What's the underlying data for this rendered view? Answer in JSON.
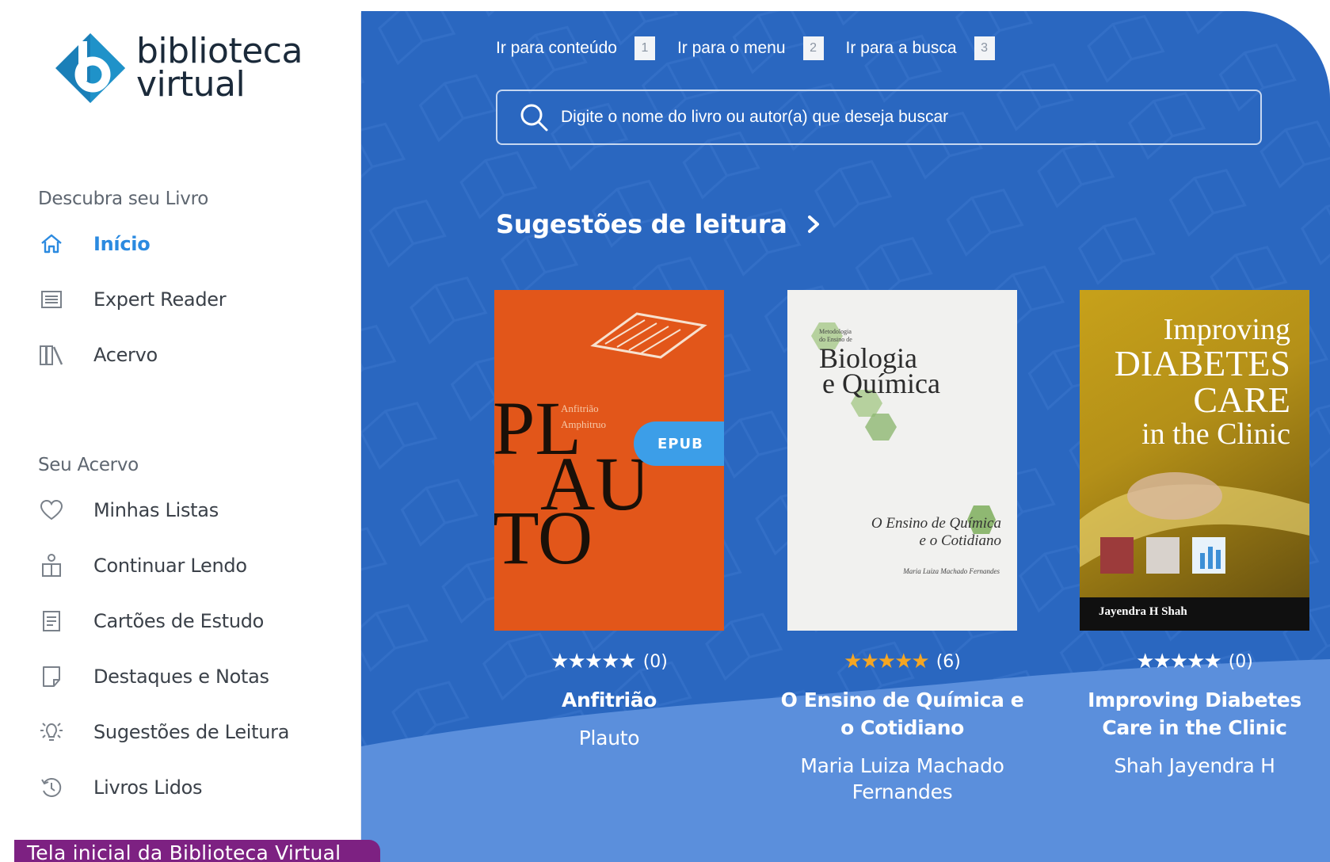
{
  "sidebar": {
    "logo": {
      "line1": "biblioteca",
      "line2": "virtual"
    },
    "sections": [
      {
        "title": "Descubra seu Livro",
        "items": [
          {
            "label": "Início",
            "icon": "home-icon",
            "active": true
          },
          {
            "label": "Expert Reader",
            "icon": "list-icon"
          },
          {
            "label": "Acervo",
            "icon": "books-icon"
          }
        ]
      },
      {
        "title": "Seu Acervo",
        "items": [
          {
            "label": "Minhas Listas",
            "icon": "heart-icon"
          },
          {
            "label": "Continuar Lendo",
            "icon": "reader-icon"
          },
          {
            "label": "Cartões de Estudo",
            "icon": "card-icon"
          },
          {
            "label": "Destaques e Notas",
            "icon": "note-icon"
          },
          {
            "label": "Sugestões de Leitura",
            "icon": "lightbulb-icon"
          },
          {
            "label": "Livros Lidos",
            "icon": "history-icon"
          }
        ]
      }
    ]
  },
  "caption": "Tela inicial da Biblioteca Virtual",
  "skiplinks": [
    {
      "label": "Ir para conteúdo",
      "key": "1"
    },
    {
      "label": "Ir para o menu",
      "key": "2"
    },
    {
      "label": "Ir para a busca",
      "key": "3"
    }
  ],
  "search": {
    "placeholder": "Digite o nome do livro ou autor(a) que deseja buscar"
  },
  "suggestions": {
    "title": "Sugestões de leitura",
    "books": [
      {
        "title": "Anfitrião",
        "author": "Plauto",
        "rating_count": "(0)",
        "rating_stars": 0,
        "badge": "EPUB",
        "cover": {
          "lines": [
            "PL",
            "AU",
            "TO"
          ],
          "subtitle": [
            "Anfitrião",
            "Amphitruo"
          ]
        }
      },
      {
        "title": "O Ensino de Química e o Cotidiano",
        "author": "Maria Luiza Machado Fernandes",
        "rating_count": "(6)",
        "rating_stars": 5,
        "cover": {
          "series": [
            "Metodologia",
            "do Ensino de"
          ],
          "heading": [
            "Biologia",
            "e Química"
          ],
          "subtitle": [
            "O Ensino de Química",
            "e o Cotidiano"
          ],
          "author": "Maria Luiza Machado Fernandes"
        }
      },
      {
        "title": "Improving Diabetes Care in the Clinic",
        "author": "Shah Jayendra H",
        "rating_count": "(0)",
        "rating_stars": 0,
        "cover": {
          "heading": [
            "Improving",
            "DIABETES",
            "CARE",
            "in the Clinic"
          ],
          "author": "Jayendra H Shah"
        }
      }
    ]
  },
  "colors": {
    "main_bg": "#2a67c0",
    "active_nav": "#2b8ae0",
    "star_filled": "#f5a623",
    "star_empty": "#ffffff",
    "caption_bg": "#7d2182",
    "epub_badge": "#3c9ee8"
  }
}
